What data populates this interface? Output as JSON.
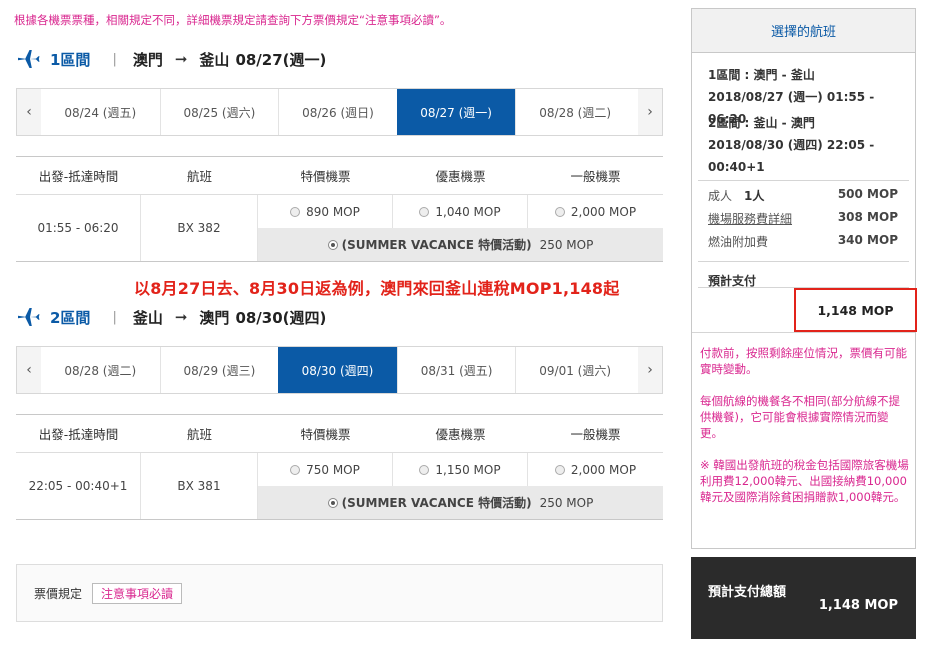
{
  "notice": "根據各機票票種，相關規定不同，詳細機票規定請查詢下方票價規定“注意事項必讀”。",
  "legs": [
    {
      "num_label": "1區間",
      "sep": "|",
      "from": "澳門",
      "arrow": "➞",
      "to": "釜山",
      "date": "08/27(週一)",
      "dates": [
        "08/24 (週五)",
        "08/25 (週六)",
        "08/26 (週日)",
        "08/27 (週一)",
        "08/28 (週二)"
      ],
      "selected_index": 3,
      "headers": [
        "出發-抵達時間",
        "航班",
        "特價機票",
        "優惠機票",
        "一般機票"
      ],
      "time": "01:55 - 06:20",
      "flight": "BX 382",
      "fares": [
        "890 MOP",
        "1,040 MOP",
        "2,000 MOP"
      ],
      "promo_name": "(SUMMER VACANCE 特價活動)",
      "promo_price": "250 MOP"
    },
    {
      "num_label": "2區間",
      "sep": "|",
      "from": "釜山",
      "arrow": "➞",
      "to": "澳門",
      "date": "08/30(週四)",
      "dates": [
        "08/28 (週二)",
        "08/29 (週三)",
        "08/30 (週四)",
        "08/31 (週五)",
        "09/01 (週六)"
      ],
      "selected_index": 2,
      "headers": [
        "出發-抵達時間",
        "航班",
        "特價機票",
        "優惠機票",
        "一般機票"
      ],
      "time": "22:05 - 00:40+1",
      "flight": "BX 381",
      "fares": [
        "750 MOP",
        "1,150 MOP",
        "2,000 MOP"
      ],
      "promo_name": "(SUMMER VACANCE 特價活動)",
      "promo_price": "250 MOP"
    }
  ],
  "nav": {
    "prev": "‹",
    "next": "›"
  },
  "banner": "以8月27日去、8月30日返為例，澳門來回釜山連稅MOP1,148起",
  "rules": {
    "label": "票價規定",
    "link": "注意事項必讀"
  },
  "sidebar": {
    "title": "選擇的航班",
    "leg1": {
      "line1": "1區間 : 澳門 - 釜山",
      "line2": "2018/08/27 (週一) 01:55 - 06:20"
    },
    "leg2": {
      "line1": "2區間 : 釜山 - 澳門",
      "line2": "2018/08/30 (週四) 22:05 -",
      "line3": "00:40+1"
    },
    "adult_label": "成人",
    "adult_count": "1人",
    "adult_price": "500 MOP",
    "airport_fee_label": "機場服務費詳細",
    "airport_fee": "308 MOP",
    "fuel_label": "燃油附加費",
    "fuel": "340 MOP",
    "est_label": "預計支付",
    "est_value": "1,148 MOP",
    "notes": [
      "付款前，按照剩餘座位情況，票價有可能實時變動。",
      "每個航線的機餐各不相同(部分航線不提供機餐)，它可能會根據實際情況而變更。",
      "※ 韓國出發航班的稅金包括國際旅客機場利用費12,000韓元、出國接納費10,000韓元及國際消除貧困捐贈款1,000韓元。"
    ]
  },
  "total": {
    "label": "預計支付總額",
    "value": "1,148 MOP"
  },
  "colors": {
    "brand_blue": "#0b5aa6",
    "accent_pink": "#d9278f",
    "banner_red": "#e2231a",
    "dark": "#2b2b2b"
  }
}
